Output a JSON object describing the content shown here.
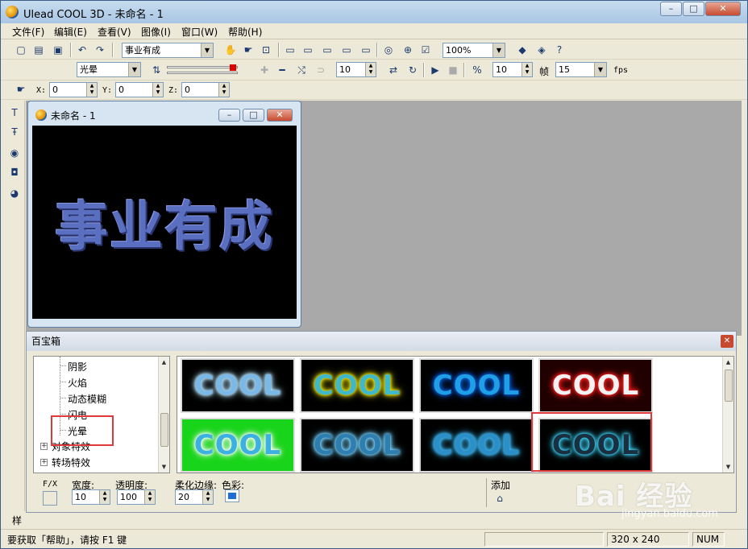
{
  "window": {
    "title": "Ulead COOL 3D - 未命名 - 1",
    "min": "–",
    "max": "□",
    "close": "✕"
  },
  "menu": [
    "文件(F)",
    "编辑(E)",
    "查看(V)",
    "图像(I)",
    "窗口(W)",
    "帮助(H)"
  ],
  "toolbar1": {
    "text_combo": "事业有成",
    "zoom_combo": "100%"
  },
  "toolbar2": {
    "effect_combo": "光晕",
    "frame_value": "10",
    "step_value": "10",
    "frame_label": "帧",
    "fps_value": "15",
    "fps_label": "fps"
  },
  "toolbar3": {
    "x_label": "X:",
    "x_value": "0",
    "y_label": "Y:",
    "y_value": "0",
    "z_label": "Z:",
    "z_value": "0"
  },
  "document": {
    "title": "未命名 - 1",
    "text": "事业有成"
  },
  "panel": {
    "title": "百宝箱",
    "tree": [
      {
        "label": "阴影"
      },
      {
        "label": "火焰"
      },
      {
        "label": "动态模糊"
      },
      {
        "label": "闪电"
      },
      {
        "label": "光晕"
      },
      {
        "label": "对象特效"
      },
      {
        "label": "转场特效"
      }
    ],
    "thumbnails": [
      {
        "text": "COOL",
        "fill": "#7ab8e8",
        "glow": "#b9e6ff",
        "bg": "#000000"
      },
      {
        "text": "COOL",
        "fill": "#40b8cc",
        "glow": "#f2e600",
        "bg": "#000000"
      },
      {
        "text": "COOL",
        "fill": "#1fa0e6",
        "glow": "#0a5cd6",
        "bg": "#000000"
      },
      {
        "text": "COOL",
        "fill": "#f2f2f2",
        "glow": "#ff2020",
        "bg": "#200000"
      },
      {
        "text": "COOL",
        "fill": "#3cb0e0",
        "glow": "#ffffff",
        "bg": "#18d41a"
      },
      {
        "text": "COOL",
        "fill": "#2e7fb0",
        "glow": "#7ad4ff",
        "bg": "#000000"
      },
      {
        "text": "COOL",
        "fill": "#2c8fc8",
        "glow": "#40c0ff",
        "bg": "#000000"
      },
      {
        "text": "COOL",
        "fill": "#1a3040",
        "glow": "#40d8ff",
        "bg": "#000000"
      }
    ],
    "props": {
      "fx_label": "F/X",
      "width_label": "宽度:",
      "width_value": "10",
      "opacity_label": "透明度:",
      "opacity_value": "100",
      "soft_label": "柔化边缘:",
      "soft_value": "20",
      "color_label": "色彩:",
      "color": "#1a6fd8",
      "add_label": "添加"
    }
  },
  "status": {
    "help": "要获取「帮助」，请按 F1 键",
    "size": "320 x 240",
    "num": "NUM",
    "partial": "样"
  },
  "watermark": {
    "main": "Bai 经验",
    "sub": "jingyan.baidu.com"
  },
  "accent": "#e0393c"
}
